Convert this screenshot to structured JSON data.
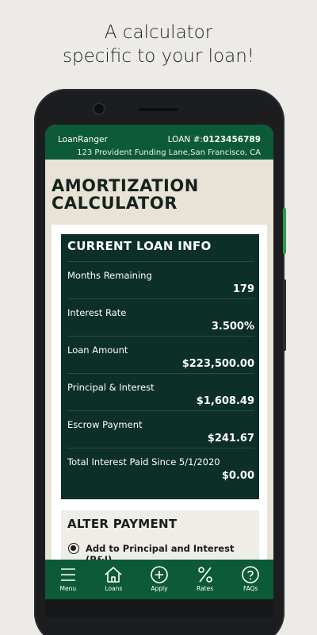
{
  "promo": {
    "line1": "A calculator",
    "line2": "specific to your loan!"
  },
  "header": {
    "brand": "LoanRanger",
    "loan_prefix": "LOAN #:",
    "loan_number": "0123456789",
    "address": "123 Provident Funding Lane,San Francisco, CA"
  },
  "page": {
    "title_line1": "AMORTIZATION",
    "title_line2": "CALCULATOR"
  },
  "loan_info": {
    "title": "CURRENT LOAN INFO",
    "rows": [
      {
        "label": "Months Remaining",
        "value": "179"
      },
      {
        "label": "Interest Rate",
        "value": "3.500%"
      },
      {
        "label": "Loan Amount",
        "value": "$223,500.00"
      },
      {
        "label": "Principal & Interest",
        "value": "$1,608.49"
      },
      {
        "label": "Escrow Payment",
        "value": "$241.67"
      },
      {
        "label": "Total Interest Paid Since 5/1/2020",
        "value": "$0.00"
      }
    ]
  },
  "alter_payment": {
    "title": "ALTER PAYMENT",
    "option_label": "Add to Principal and Interest (P&I)"
  },
  "nav": {
    "items": [
      {
        "label": "Menu",
        "icon": "menu-icon"
      },
      {
        "label": "Loans",
        "icon": "home-icon"
      },
      {
        "label": "Apply",
        "icon": "plus-circle-icon"
      },
      {
        "label": "Rates",
        "icon": "percent-icon"
      },
      {
        "label": "FAQs",
        "icon": "question-circle-icon"
      }
    ]
  },
  "colors": {
    "primary_green": "#0d5a39",
    "card_dark": "#0c2f28",
    "screen_bg": "#e8e2d7",
    "accent_button": "#2f9a4a"
  }
}
